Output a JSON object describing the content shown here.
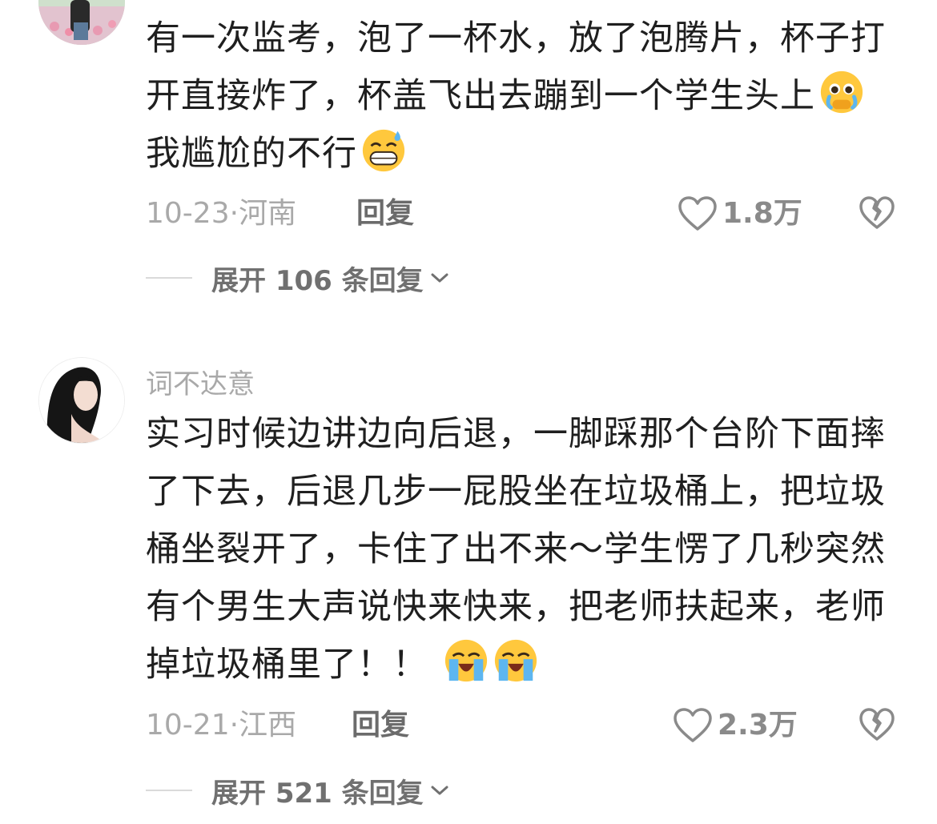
{
  "comments": [
    {
      "username": "",
      "text": "有一次监考，泡了一杯水，放了泡腾片，杯子打开直接炸了，杯盖飞出去蹦到一个学生头上",
      "text_tail": "我尴尬的不行",
      "emojis": [
        "pleading-crying-face-emoji",
        "grinning-sweat-face-emoji"
      ],
      "date": "10-23·",
      "location": "河南",
      "reply_label": "回复",
      "likes": "1.8万",
      "expand_label": "展开 106 条回复"
    },
    {
      "username": "词不达意",
      "text": "实习时候边讲边向后退，一脚踩那个台阶下面摔了下去，后退几步一屁股坐在垃圾桶上，把垃圾桶坐裂开了，卡住了出不来～学生愣了几秒突然有个男生大声说快来快来，把老师扶起来，老师掉垃圾桶里了！！",
      "emojis": [
        "loudly-crying-face-emoji",
        "loudly-crying-face-emoji"
      ],
      "date": "10-21·",
      "location": "江西",
      "reply_label": "回复",
      "likes": "2.3万",
      "expand_label": "展开 521 条回复"
    }
  ],
  "icons": [
    "heart-icon",
    "broken-heart-icon",
    "chevron-down-icon"
  ],
  "colors": {
    "meta_gray": "#a9a9a9",
    "reply_gray": "#6b6b6b",
    "text": "#1f1f1f"
  }
}
